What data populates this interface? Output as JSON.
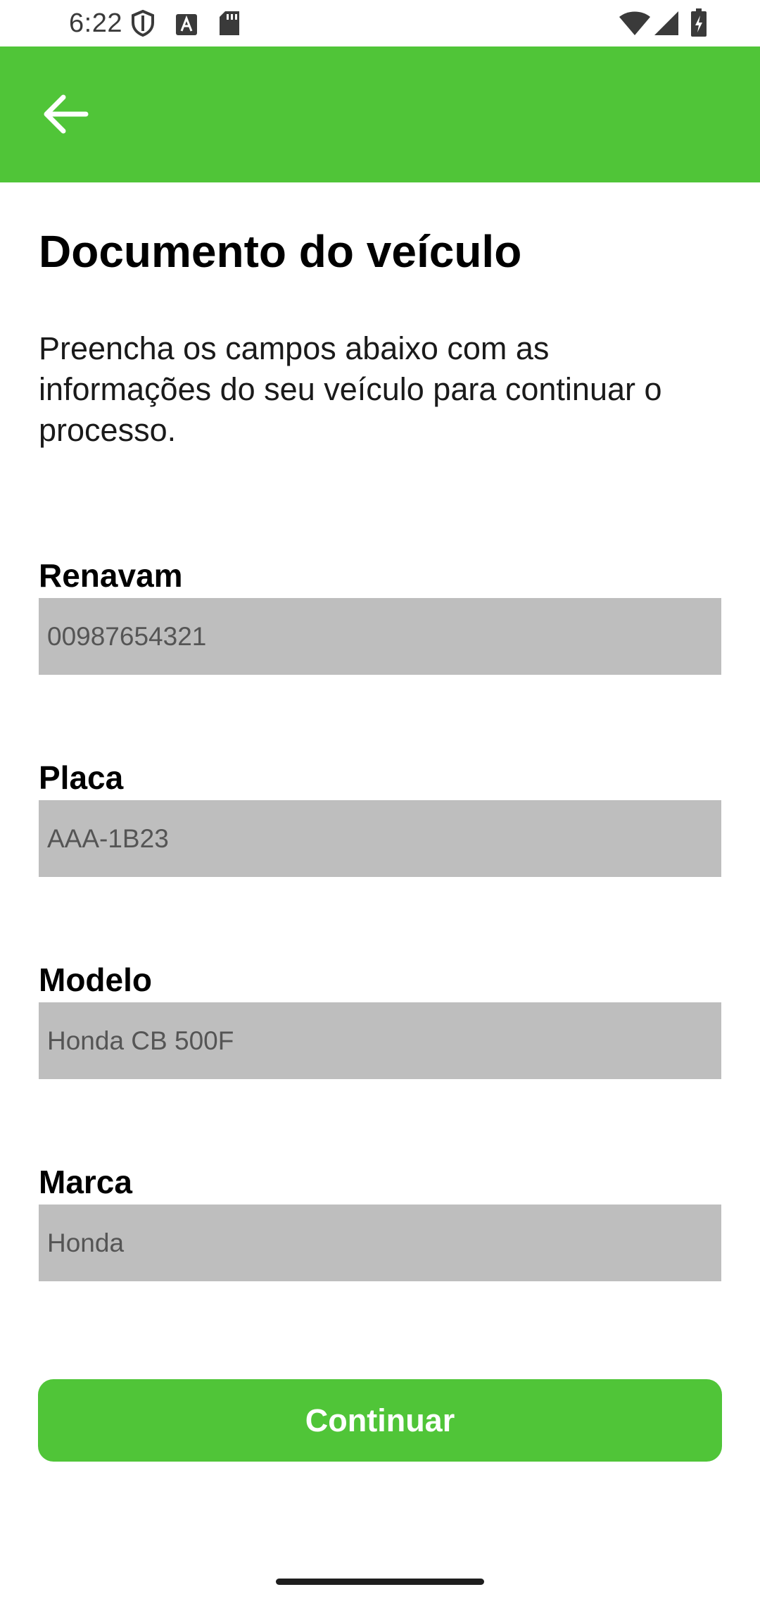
{
  "status_bar": {
    "time": "6:22",
    "icons_left": [
      "shield-icon",
      "text-a-icon",
      "sd-card-icon"
    ],
    "icons_right": [
      "wifi-icon",
      "signal-icon",
      "battery-charging-icon"
    ]
  },
  "app_bar": {
    "back_icon": "arrow-left-icon",
    "color": "#50C538"
  },
  "page": {
    "title": "Documento do veículo",
    "description": "Preencha os campos abaixo com as informações do seu veículo para continuar o processo."
  },
  "form": {
    "renavam": {
      "label": "Renavam",
      "value": "00987654321"
    },
    "placa": {
      "label": "Placa",
      "value": "AAA-1B23"
    },
    "modelo": {
      "label": "Modelo",
      "value": "Honda CB 500F"
    },
    "marca": {
      "label": "Marca",
      "value": "Honda"
    }
  },
  "actions": {
    "continue_label": "Continuar"
  },
  "colors": {
    "accent": "#50C538",
    "input_bg": "#BEBEBE",
    "input_text": "#555555"
  }
}
